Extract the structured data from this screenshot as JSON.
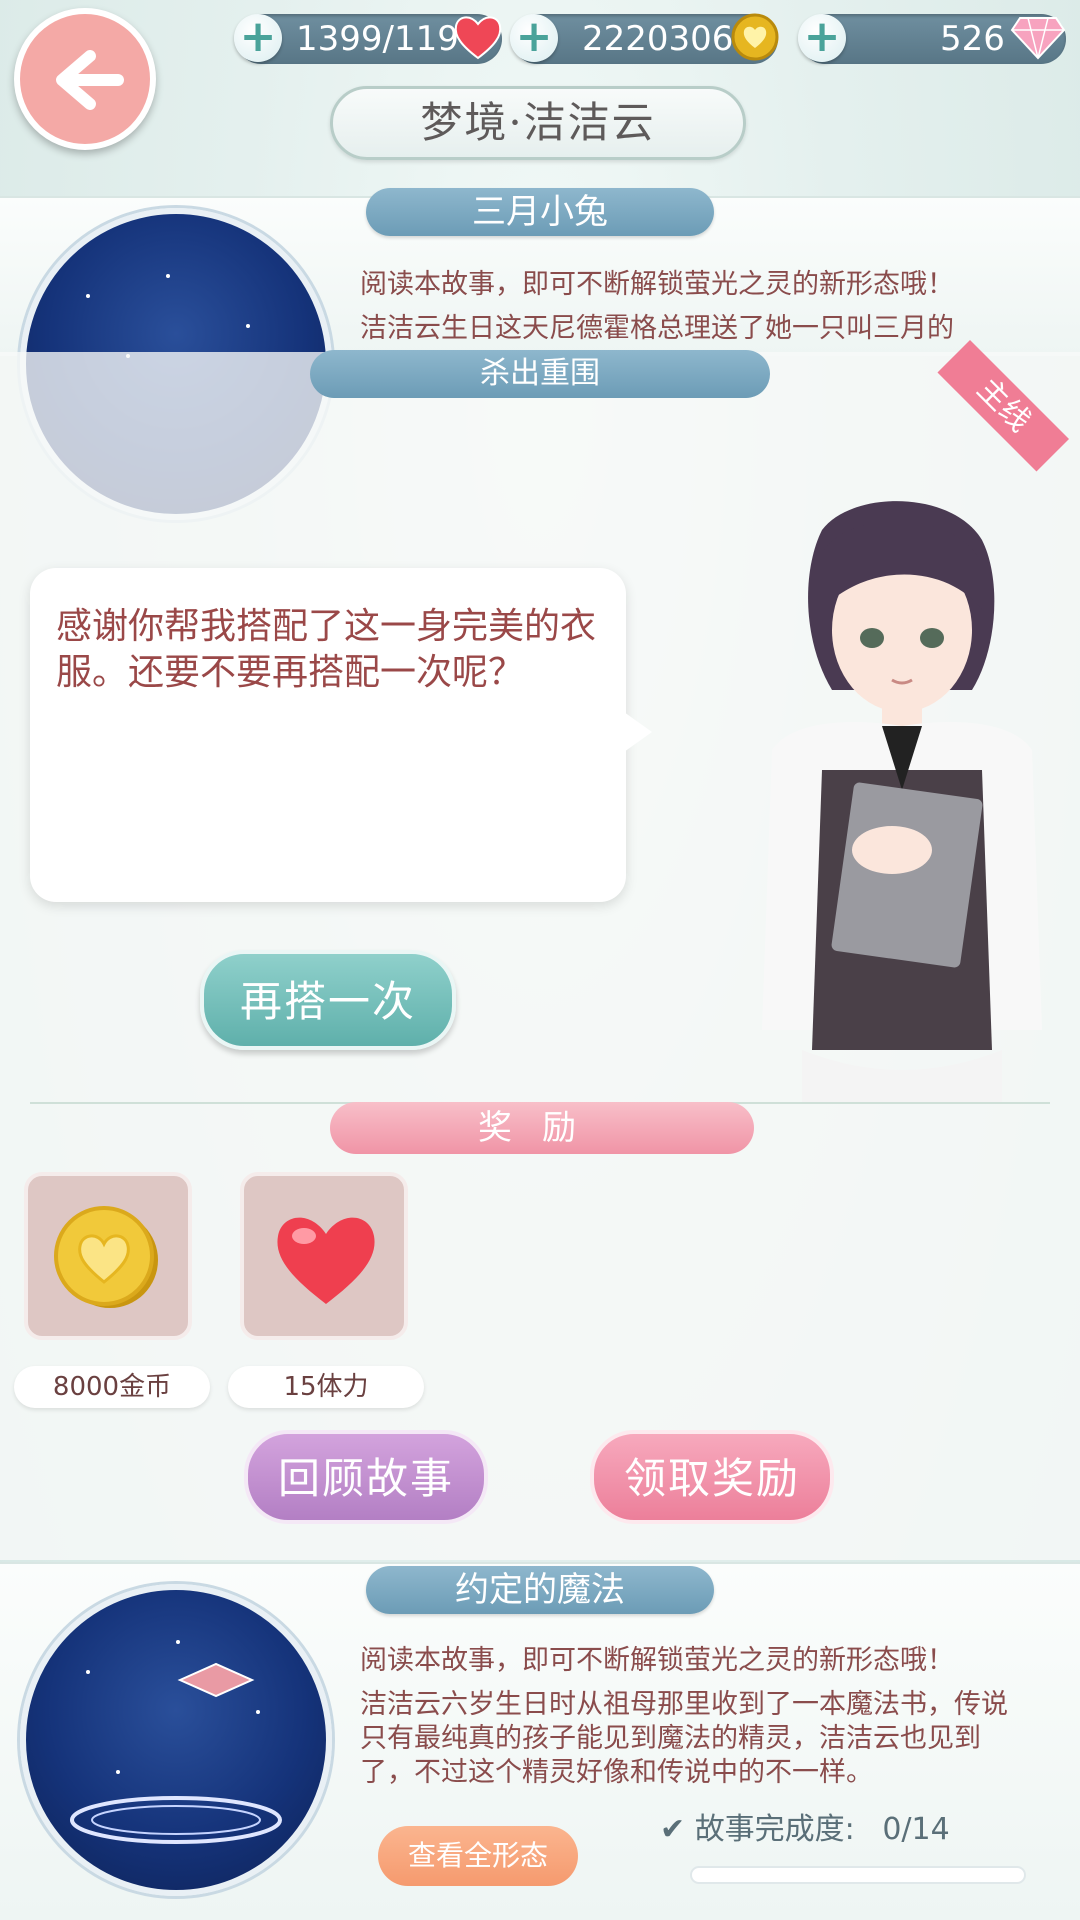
{
  "top_bar": {
    "stamina": "1399/119",
    "gold": "2220306",
    "gems": "526",
    "plus_symbol": "+"
  },
  "title": "梦境·洁洁云",
  "story_top": {
    "banner": "三月小兔",
    "desc_line1": "阅读本故事，即可不断解锁萤光之灵的新形态哦！",
    "desc_line2": "洁洁云生日这天尼德霍格总理送了她一只叫三月的"
  },
  "popup": {
    "chapter_banner": "杀出重围",
    "mainline_tag": "主线",
    "dialog_text": "感谢你帮我搭配了这一身完美的衣服。还要不要再搭配一次呢？",
    "again_button": "再搭一次",
    "reward_banner": "奖励",
    "rewards": [
      {
        "label": "8000金币",
        "icon": "gold-coin-icon"
      },
      {
        "label": "15体力",
        "icon": "heart-icon"
      }
    ],
    "review_button": "回顾故事",
    "claim_button": "领取奖励"
  },
  "story_bottom": {
    "banner": "约定的魔法",
    "desc_line1": "阅读本故事，即可不断解锁萤光之灵的新形态哦！",
    "desc_body": "洁洁云六岁生日时从祖母那里收到了一本魔法书，传说只有最纯真的孩子能见到魔法的精灵，洁洁云也见到了，不过这个精灵好像和传说中的不一样。",
    "view_button": "查看全形态",
    "progress_label": "故事完成度:",
    "progress_value": "0/14"
  }
}
